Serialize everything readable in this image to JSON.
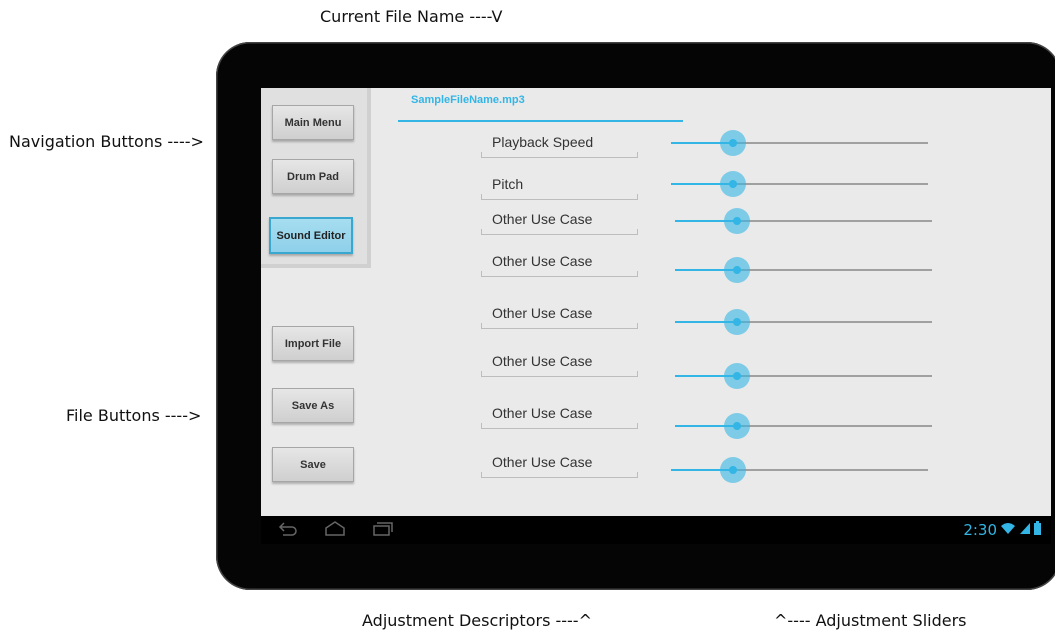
{
  "annotations": {
    "top": "Current File Name ----V",
    "nav": "Navigation Buttons ---->",
    "file": "File Buttons ---->",
    "desc": "Adjustment Descriptors ----^",
    "slider": "^---- Adjustment Sliders"
  },
  "app": {
    "filename": "SampleFileName.mp3",
    "nav_buttons": [
      "Main Menu",
      "Drum Pad",
      "Sound Editor"
    ],
    "active_nav": "Sound Editor",
    "file_buttons": [
      "Import File",
      "Save As",
      "Save"
    ],
    "adjustments": [
      {
        "label": "Playback Speed",
        "value": 0.24
      },
      {
        "label": "Pitch",
        "value": 0.24
      },
      {
        "label": "Other Use Case",
        "value": 0.24
      },
      {
        "label": "Other Use Case",
        "value": 0.24
      },
      {
        "label": "Other Use Case",
        "value": 0.24
      },
      {
        "label": "Other Use Case",
        "value": 0.24
      },
      {
        "label": "Other Use Case",
        "value": 0.24
      },
      {
        "label": "Other Use Case",
        "value": 0.24
      }
    ]
  },
  "statusbar": {
    "time": "2:30"
  },
  "colors": {
    "accent": "#33b5e5"
  }
}
